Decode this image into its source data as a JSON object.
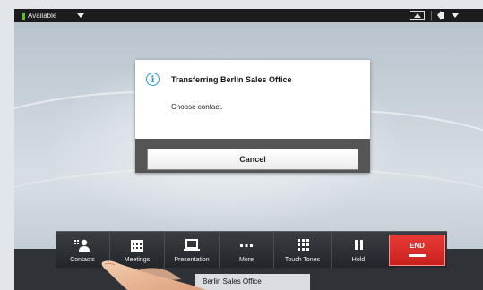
{
  "status_bar": {
    "availability": "Available",
    "indicator_color": "#58c21c",
    "icons": [
      "chevron-down-icon",
      "self-view-icon",
      "speaker-icon",
      "chevron-down-icon"
    ]
  },
  "dialog": {
    "icon": "info-icon",
    "title": "Transferring Berlin Sales Office",
    "message": "Choose contact.",
    "cancel_label": "Cancel"
  },
  "toolbar": {
    "buttons": [
      {
        "label": "Contacts",
        "icon": "contacts-icon"
      },
      {
        "label": "Meetings",
        "icon": "calendar-icon"
      },
      {
        "label": "Presentation",
        "icon": "laptop-icon"
      },
      {
        "label": "More",
        "icon": "more-icon"
      },
      {
        "label": "Touch Tones",
        "icon": "keypad-icon"
      },
      {
        "label": "Hold",
        "icon": "pause-icon"
      }
    ],
    "end_label": "END",
    "end_color": "#d42a26"
  },
  "call": {
    "remote_name": "Berlin Sales Office"
  }
}
